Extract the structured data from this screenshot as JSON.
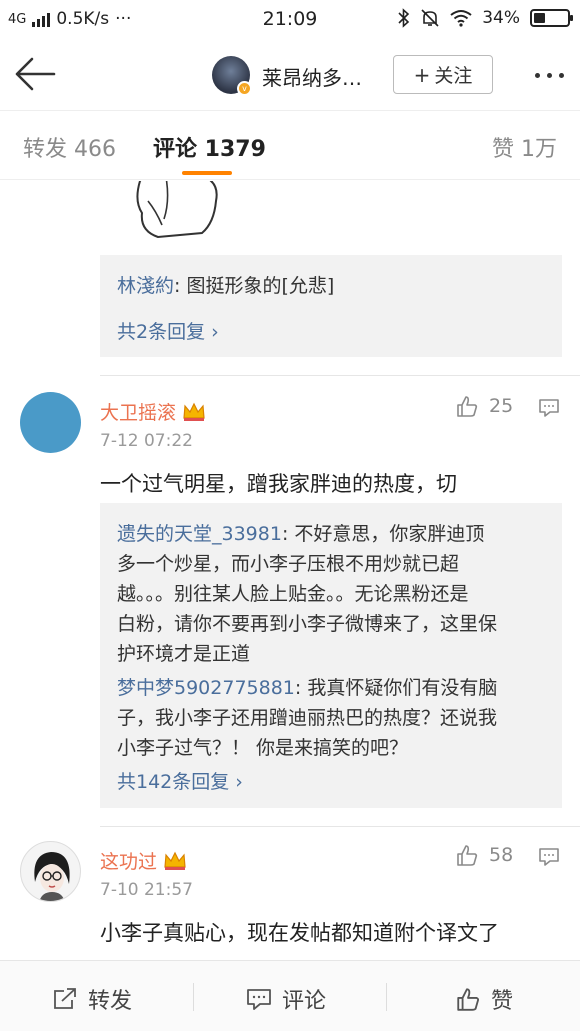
{
  "status_bar": {
    "network": "4G",
    "speed": "0.5K/s",
    "dots": "···",
    "time": "21:09",
    "battery": "34%",
    "battery_level": 0.34
  },
  "header": {
    "user_name": "莱昂纳多…",
    "follow_label": "关注",
    "follow_plus": "+"
  },
  "tabs": {
    "repost": "转发 466",
    "comment": "评论 1379",
    "like": "赞 1万"
  },
  "top_reply_box": {
    "replies": [
      {
        "user": "林淺約",
        "sep": ": ",
        "text": "图挺形象的[允悲]"
      }
    ],
    "more": "共2条回复 ›"
  },
  "comments": [
    {
      "name": "大卫摇滚",
      "time": "7-12 07:22",
      "text": "一个过气明星，蹭我家胖迪的热度，切",
      "likes": "25",
      "replies": [
        {
          "user": "遗失的天堂_33981",
          "sep": ": ",
          "lines": [
            "不好意思，你家胖迪顶",
            "多一个炒星，而小李子压根不用炒就已超",
            "越。。。别往某人脸上贴金。。无论黑粉还是",
            "白粉，请你不要再到小李子微博来了，这里保",
            "护环境才是正道"
          ]
        },
        {
          "user": "梦中梦5902775881",
          "sep": ": ",
          "lines": [
            "我真怀疑你们有没有脑",
            "子，我小李子还用蹭迪丽热巴的热度？还说我",
            "小李子过气？！ 你是来搞笑的吧？"
          ]
        }
      ],
      "more": "共142条回复 ›"
    },
    {
      "name": "这功过",
      "time": "7-10 21:57",
      "text": "小李子真贴心，现在发帖都知道附个译文了",
      "likes": "58"
    }
  ],
  "bottom_bar": {
    "repost": "转发",
    "comment": "评论",
    "like": "赞"
  },
  "colors": {
    "accent_orange": "#ff8200",
    "link_blue": "#4a6e9c",
    "username_orange": "#eb7350"
  },
  "icons": [
    "back-arrow-icon",
    "bluetooth-icon",
    "mute-bell-icon",
    "wifi-icon",
    "battery-icon",
    "more-dots-icon",
    "thumbs-up-icon",
    "reply-bubble-icon",
    "share-icon",
    "comment-icon",
    "crown-icon"
  ]
}
